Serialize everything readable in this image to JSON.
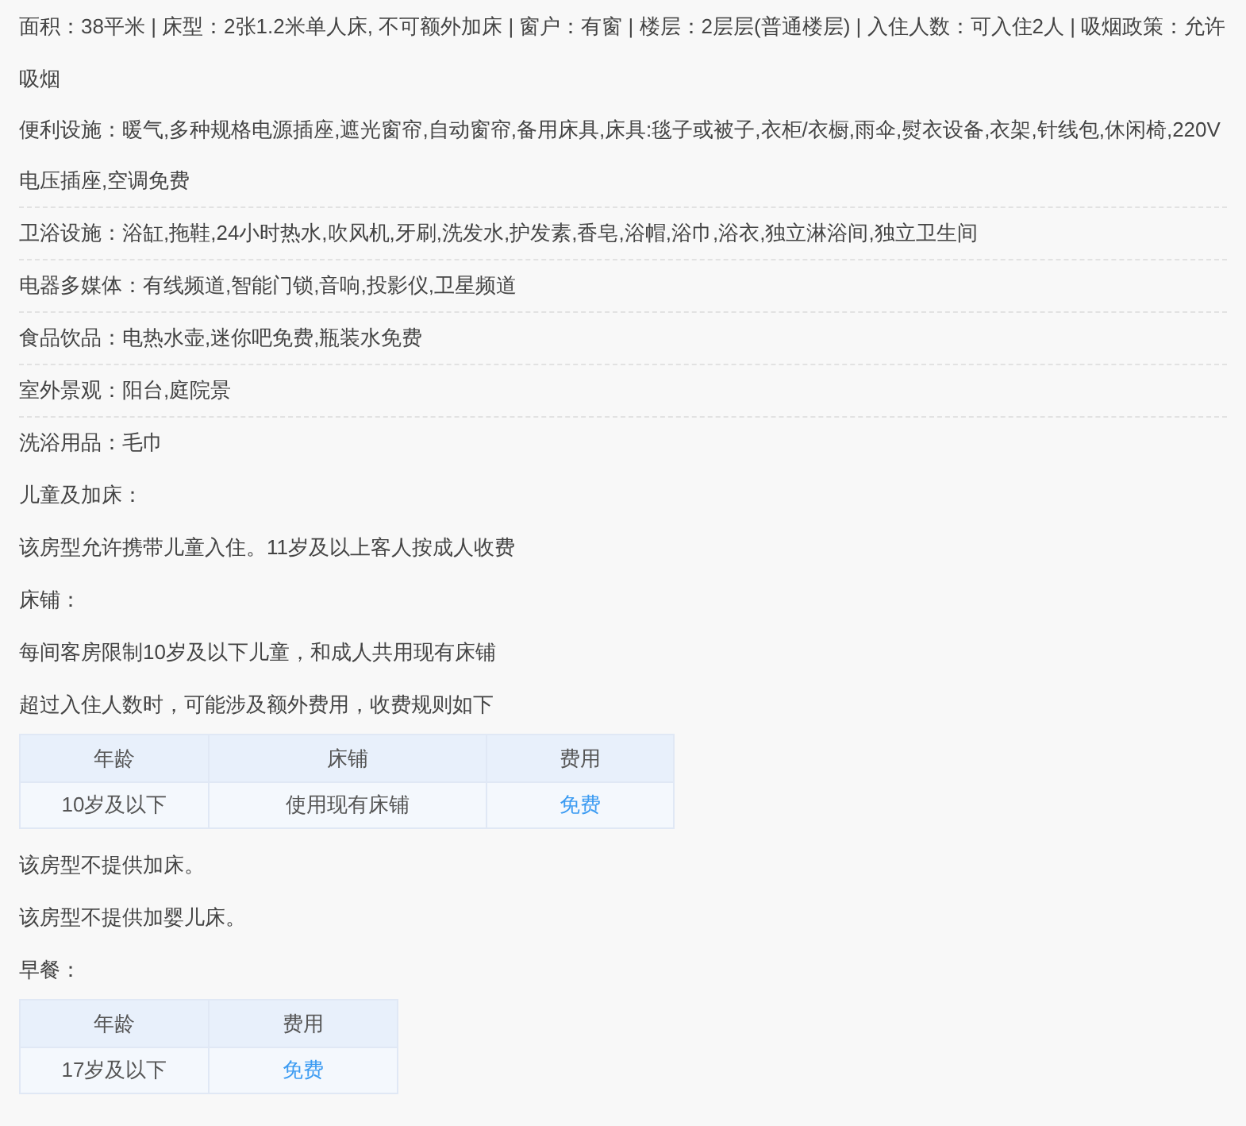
{
  "summary": "面积：38平米 | 床型：2张1.2米单人床, 不可额外加床 | 窗户：有窗 | 楼层：2层层(普通楼层) | 入住人数：可入住2人 | 吸烟政策：允许吸烟",
  "facilities": [
    {
      "text": "便利设施：暖气,多种规格电源插座,遮光窗帘,自动窗帘,备用床具,床具:毯子或被子,衣柜/衣橱,雨伞,熨衣设备,衣架,针线包,休闲椅,220V电压插座,空调免费"
    },
    {
      "text": "卫浴设施：浴缸,拖鞋,24小时热水,吹风机,牙刷,洗发水,护发素,香皂,浴帽,浴巾,浴衣,独立淋浴间,独立卫生间"
    },
    {
      "text": "电器多媒体：有线频道,智能门锁,音响,投影仪,卫星频道"
    },
    {
      "text": "食品饮品：电热水壶,迷你吧免费,瓶装水免费"
    },
    {
      "text": "室外景观：阳台,庭院景"
    },
    {
      "text": "洗浴用品：毛巾"
    }
  ],
  "blocks": [
    {
      "kind": "heading",
      "text": "儿童及加床："
    },
    {
      "kind": "text",
      "text": "该房型允许携带儿童入住。11岁及以上客人按成人收费"
    },
    {
      "kind": "heading",
      "text": "床铺："
    },
    {
      "kind": "text",
      "text": "每间客房限制10岁及以下儿童，和成人共用现有床铺"
    },
    {
      "kind": "text",
      "text": "超过入住人数时，可能涉及额外费用，收费规则如下"
    },
    {
      "kind": "table",
      "columns": [
        {
          "label": "年龄",
          "kind": "plain"
        },
        {
          "label": "床铺",
          "kind": "plain"
        },
        {
          "label": "费用",
          "kind": "price"
        }
      ],
      "rows": [
        [
          "10岁及以下",
          "使用现有床铺",
          "免费"
        ]
      ]
    },
    {
      "kind": "text",
      "text": "该房型不提供加床。"
    },
    {
      "kind": "text",
      "text": "该房型不提供加婴儿床。"
    },
    {
      "kind": "heading",
      "text": "早餐："
    },
    {
      "kind": "table",
      "columns": [
        {
          "label": "年龄",
          "kind": "plain"
        },
        {
          "label": "费用",
          "kind": "price"
        }
      ],
      "rows": [
        [
          "17岁及以下",
          "免费"
        ]
      ]
    }
  ]
}
